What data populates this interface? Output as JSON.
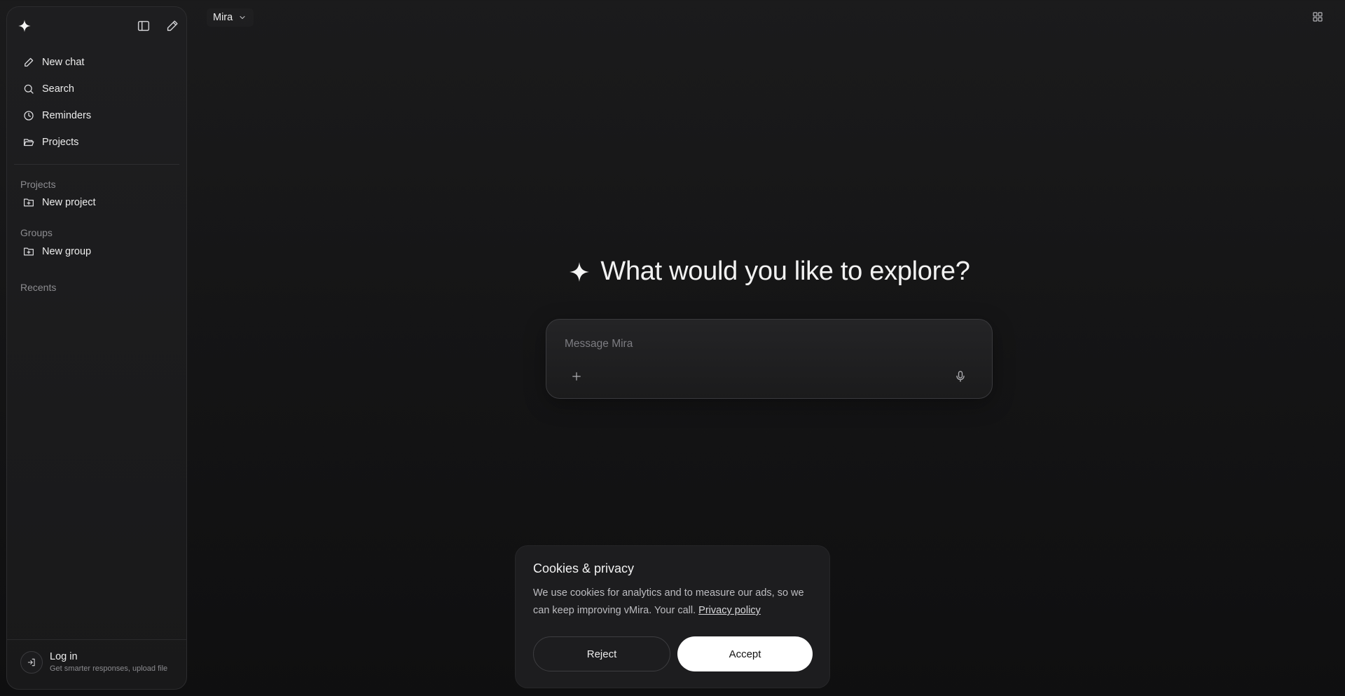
{
  "sidebar": {
    "nav": [
      {
        "label": "New chat",
        "icon": "pencil-icon"
      },
      {
        "label": "Search",
        "icon": "search-icon"
      },
      {
        "label": "Reminders",
        "icon": "clock-icon"
      },
      {
        "label": "Projects",
        "icon": "folder-open-icon"
      }
    ],
    "projects_label": "Projects",
    "new_project_label": "New project",
    "groups_label": "Groups",
    "new_group_label": "New group",
    "recents_label": "Recents",
    "login": {
      "title": "Log in",
      "subtitle": "Get smarter responses, upload file"
    }
  },
  "header": {
    "model_name": "Mira",
    "apps_icon": "grid-icon"
  },
  "hero": {
    "title": "What would you like to explore?",
    "icon": "sparkle-icon"
  },
  "composer": {
    "placeholder": "Message Mira",
    "value": ""
  },
  "cookie_banner": {
    "title": "Cookies & privacy",
    "text": "We use cookies for analytics and to measure our ads, so we can keep improving vMira. Your call.",
    "link_label": "Privacy policy",
    "reject_label": "Reject",
    "accept_label": "Accept"
  },
  "colors": {
    "background": "#141415",
    "sidebar": "#1c1c1e",
    "accept_button": "#ffffff",
    "text": "#ececec"
  }
}
